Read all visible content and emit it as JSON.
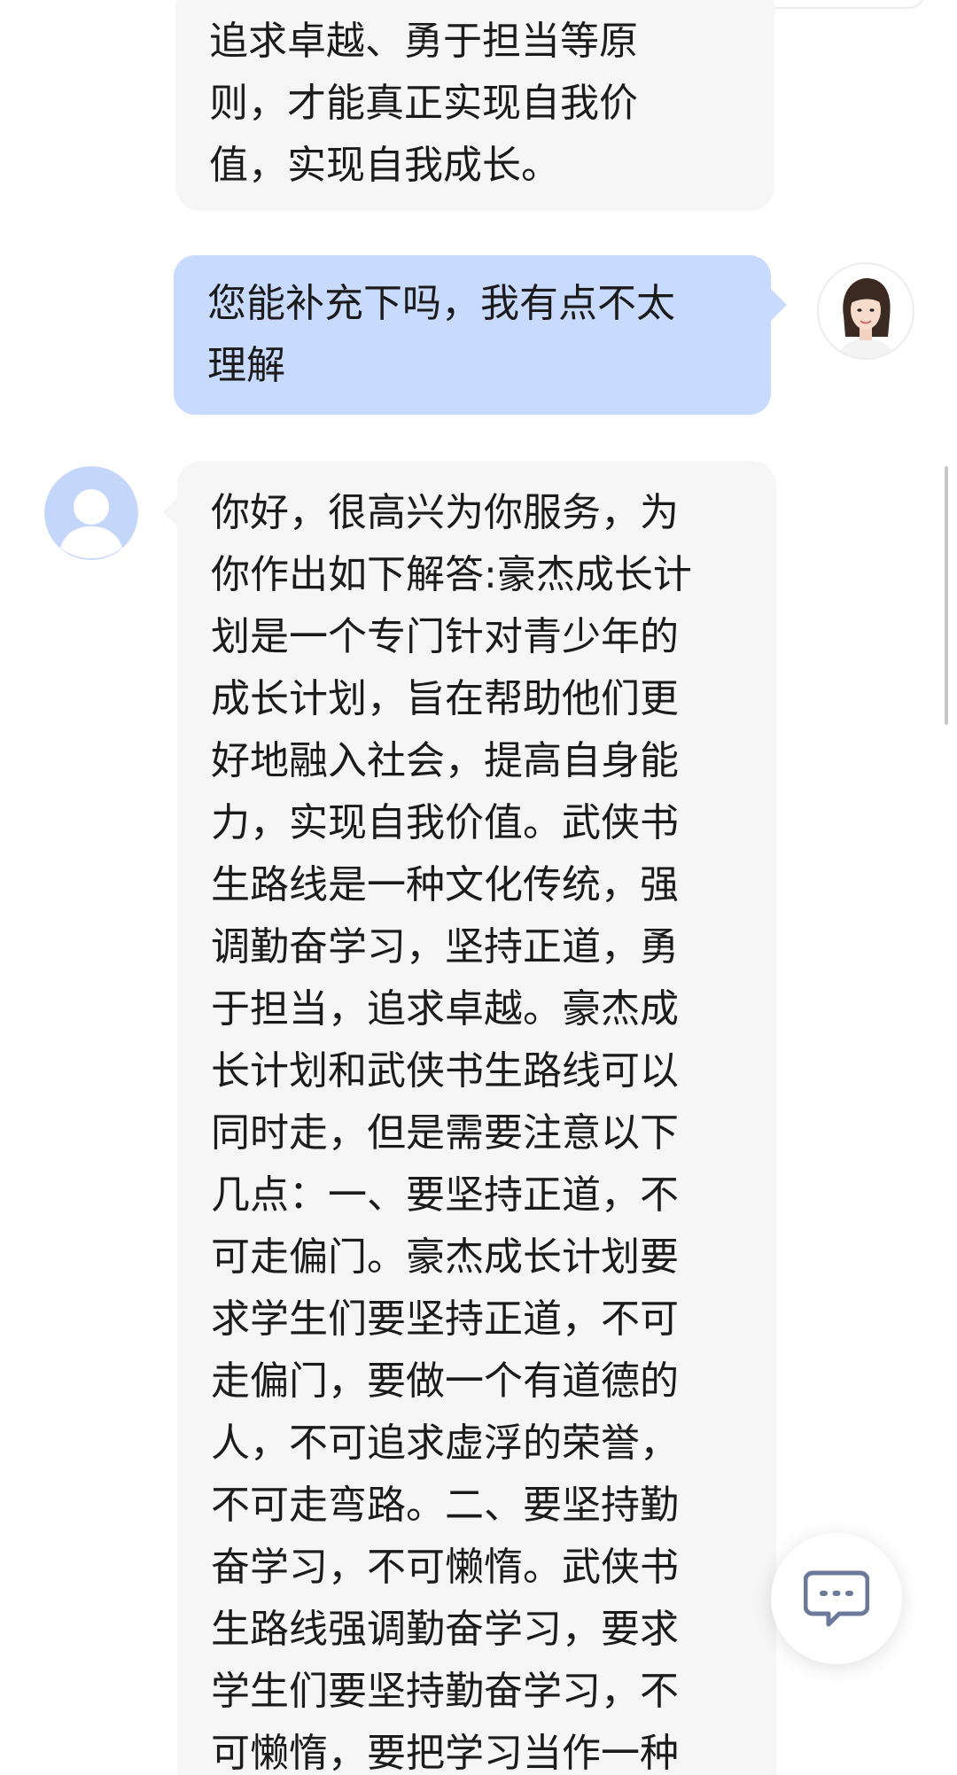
{
  "messages": [
    {
      "role": "bot",
      "text": "追求卓越、勇于担当等原\n则，才能真正实现自我价\n值，实现自我成长。"
    },
    {
      "role": "user",
      "text": "您能补充下吗，我有点不太\n理解"
    },
    {
      "role": "bot",
      "text": "你好，很高兴为你服务，为\n你作出如下解答:豪杰成长计\n划是一个专门针对青少年的\n成长计划，旨在帮助他们更\n好地融入社会，提高自身能\n力，实现自我价值。武侠书\n生路线是一种文化传统，强\n调勤奋学习，坚持正道，勇\n于担当，追求卓越。豪杰成\n长计划和武侠书生路线可以\n同时走，但是需要注意以下\n几点：一、要坚持正道，不\n可走偏门。豪杰成长计划要\n求学生们要坚持正道，不可\n走偏门，要做一个有道德的\n人，不可追求虚浮的荣誉，\n不可走弯路。二、要坚持勤\n奋学习，不可懒惰。武侠书\n生路线强调勤奋学习，要求\n学生们要坚持勤奋学习，不\n可懒惰，要把学习当作一种"
    }
  ],
  "icons": {
    "user_avatar": "user-avatar-photo",
    "bot_avatar": "default-person-avatar",
    "fab": "chat-bubble-ellipsis-icon"
  },
  "colors": {
    "user_bubble": "#c9daff",
    "bot_bubble": "#f6f6f7",
    "bot_avatar_bg": "#c5d6fb",
    "fab_icon": "#6b7a9a"
  }
}
